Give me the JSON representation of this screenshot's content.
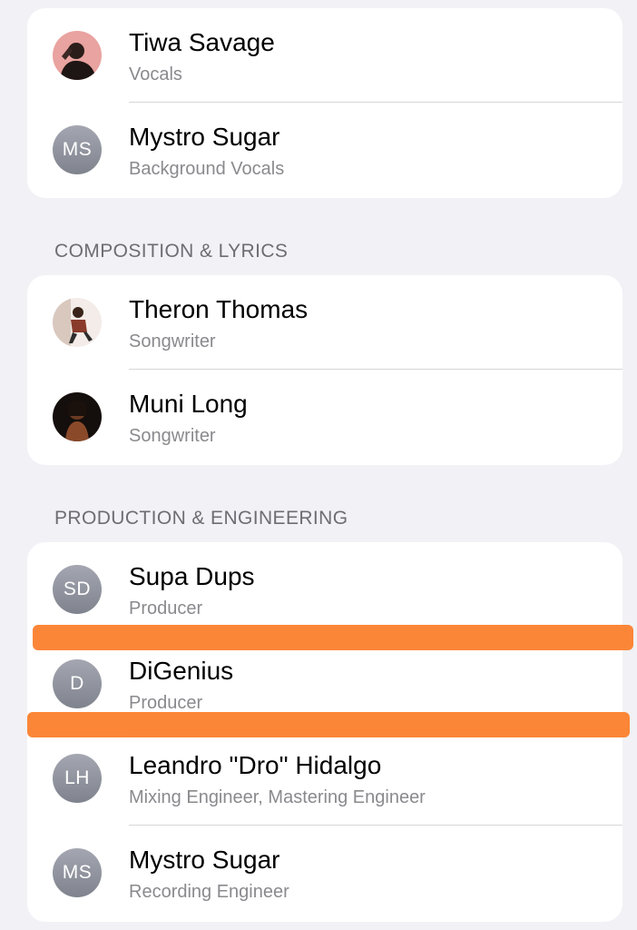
{
  "card_top": {
    "rows": [
      {
        "name": "Tiwa Savage",
        "role": "Vocals",
        "avatar": {
          "type": "photo",
          "icon": "person-photo-icon"
        }
      },
      {
        "name": "Mystro Sugar",
        "role": "Background Vocals",
        "avatar": {
          "type": "initials",
          "initials": "MS"
        }
      }
    ]
  },
  "sections": {
    "composition": {
      "header": "COMPOSITION & LYRICS",
      "rows": [
        {
          "name": "Theron Thomas",
          "role": "Songwriter",
          "avatar": {
            "type": "photo",
            "icon": "person-photo-icon"
          }
        },
        {
          "name": "Muni Long",
          "role": "Songwriter",
          "avatar": {
            "type": "photo",
            "icon": "person-photo-icon"
          }
        }
      ]
    },
    "production": {
      "header": "PRODUCTION & ENGINEERING",
      "rows": [
        {
          "name": "Supa Dups",
          "role": "Producer",
          "avatar": {
            "type": "initials",
            "initials": "SD"
          }
        },
        {
          "name": "DiGenius",
          "role": "Producer",
          "avatar": {
            "type": "initials",
            "initials": "D"
          }
        },
        {
          "name": "Leandro \"Dro\" Hidalgo",
          "role": "Mixing Engineer, Mastering Engineer",
          "avatar": {
            "type": "initials",
            "initials": "LH"
          }
        },
        {
          "name": "Mystro Sugar",
          "role": "Recording Engineer",
          "avatar": {
            "type": "initials",
            "initials": "MS"
          }
        }
      ]
    }
  },
  "colors": {
    "background": "#f1f1f6",
    "card": "#ffffff",
    "secondary_text": "#8a8a8e",
    "redaction_marker": "#fb8232"
  }
}
